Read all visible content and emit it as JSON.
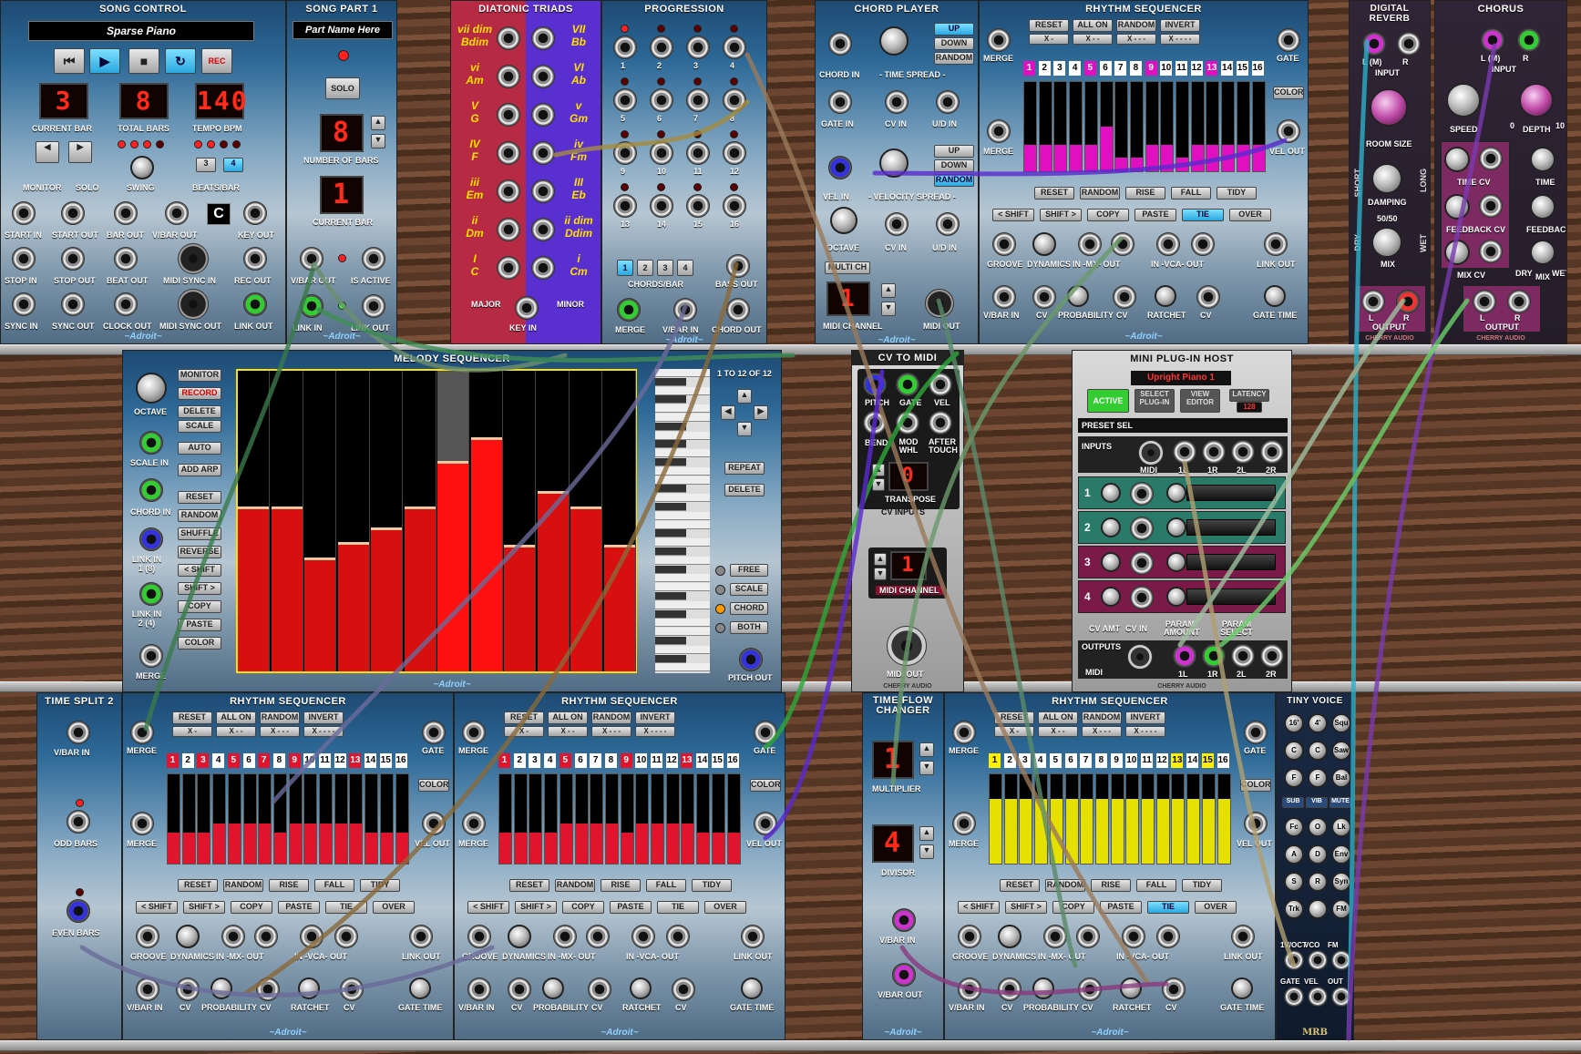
{
  "modules": {
    "song_control": {
      "title": "SONG CONTROL",
      "song_name": "Sparse Piano",
      "rec_label": "REC",
      "displays": {
        "current_bar": "3",
        "total_bars": "8",
        "tempo": "140"
      },
      "labels": [
        "CURRENT BAR",
        "TOTAL BARS",
        "TEMPO BPM",
        "MONITOR",
        "SOLO",
        "SWING",
        "BEATS/BAR",
        "START IN",
        "START OUT",
        "BAR OUT",
        "V/BAR OUT",
        "KEY OUT",
        "STOP IN",
        "STOP OUT",
        "BEAT OUT",
        "MIDI SYNC IN",
        "REC OUT",
        "SYNC IN",
        "SYNC OUT",
        "CLOCK OUT",
        "MIDI SYNC OUT",
        "LINK OUT"
      ],
      "beats": [
        "3",
        "4"
      ],
      "key": "C",
      "brand": "~Adroit~"
    },
    "song_part": {
      "title": "SONG PART 1",
      "part_name": "Part Name Here",
      "solo": "SOLO",
      "number_of_bars": "8",
      "current_bar": "1",
      "labels": [
        "NUMBER OF BARS",
        "CURRENT BAR",
        "V/BAR OUT",
        "IS ACTIVE",
        "LINK IN",
        "LINK OUT"
      ],
      "brand": "~Adroit~"
    },
    "diatonic": {
      "title": "DIATONIC TRIADS",
      "major": [
        {
          "d": "vii dim",
          "c": "Bdim"
        },
        {
          "d": "vi",
          "c": "Am"
        },
        {
          "d": "V",
          "c": "G"
        },
        {
          "d": "IV",
          "c": "F"
        },
        {
          "d": "iii",
          "c": "Em"
        },
        {
          "d": "ii",
          "c": "Dm"
        },
        {
          "d": "I",
          "c": "C"
        }
      ],
      "minor": [
        {
          "d": "VII",
          "c": "Bb"
        },
        {
          "d": "VI",
          "c": "Ab"
        },
        {
          "d": "v",
          "c": "Gm"
        },
        {
          "d": "iv",
          "c": "Fm"
        },
        {
          "d": "III",
          "c": "Eb"
        },
        {
          "d": "ii dim",
          "c": "Ddim"
        },
        {
          "d": "i",
          "c": "Cm"
        }
      ],
      "major_lbl": "MAJOR",
      "minor_lbl": "MINOR",
      "key_in": "KEY IN"
    },
    "progression": {
      "title": "PROGRESSION",
      "steps": [
        "1",
        "2",
        "3",
        "4",
        "5",
        "6",
        "7",
        "8",
        "9",
        "10",
        "11",
        "12",
        "13",
        "14",
        "15",
        "16"
      ],
      "chords_per_bar": [
        "1",
        "2",
        "3",
        "4"
      ],
      "labels": [
        "CHORDS/BAR",
        "BASS OUT",
        "MERGE",
        "V/BAR IN",
        "CHORD OUT"
      ],
      "brand": "~Adroit~"
    },
    "chord_player": {
      "title": "CHORD PLAYER",
      "modes": [
        "UP",
        "DOWN",
        "RANDOM"
      ],
      "modes2": [
        "UP",
        "DOWN",
        "RANDOM"
      ],
      "labels": [
        "CHORD IN",
        "- TIME SPREAD -",
        "GATE IN",
        "CV IN",
        "U/D IN",
        "VEL IN",
        "- VELOCITY SPREAD -",
        "OCTAVE",
        "CV IN",
        "U/D IN",
        "MULTI CH",
        "MIDI CHANNEL",
        "MIDI OUT"
      ],
      "midi_channel": "1",
      "brand": "~Adroit~"
    },
    "rhythm_top": {
      "title": "RHYTHM SEQUENCER",
      "brand": "~Adroit~"
    },
    "reverb": {
      "title": "DIGITAL REVERB",
      "labels": [
        "L (M)",
        "R",
        "INPUT",
        "ROOM SIZE",
        "SHORT",
        "LONG",
        "DAMPING",
        "DRY",
        "WET",
        "50/50",
        "MIX",
        "OUTPUT",
        "L",
        "R"
      ],
      "brand": "CHERRY AUDIO"
    },
    "chorus": {
      "title": "CHORUS",
      "labels": [
        "L (M)",
        "R",
        "INPUT",
        "SPEED",
        "0",
        "DEPTH",
        "10",
        "TIME CV",
        "TIME",
        "FEEDBACK CV",
        "FEEDBACK",
        "MIX CV",
        "DRY",
        "MIX",
        "WET",
        "OUTPUT",
        "L",
        "R"
      ],
      "brand": "CHERRY AUDIO"
    },
    "melody": {
      "title": "MELODY SEQUENCER",
      "range": "1 TO 12 OF 12",
      "buttons": [
        "MONITOR",
        "RECORD",
        "DELETE",
        "SCALE",
        "AUTO",
        "ADD ARP",
        "RESET",
        "RANDOM",
        "SHUFFLE",
        "REVERSE",
        "< SHIFT",
        "SHIFT >",
        "COPY",
        "PASTE",
        "COLOR"
      ],
      "right_buttons": [
        "REPEAT",
        "DELETE"
      ],
      "modes": [
        "FREE",
        "SCALE",
        "CHORD",
        "BOTH"
      ],
      "labels": [
        "OCTAVE",
        "SCALE IN",
        "CHORD IN",
        "LINK IN 1 (8)",
        "LINK IN 2 (4)",
        "MERGE",
        "PITCH OUT"
      ],
      "note_levels": [
        0.55,
        0.55,
        0.38,
        0.43,
        0.48,
        0.55,
        0.7,
        0.78,
        0.42,
        0.6,
        0.55,
        0.42
      ],
      "brand": "~Adroit~"
    },
    "cv_to_midi": {
      "title": "CV TO MIDI",
      "labels": [
        "PITCH",
        "GATE",
        "VEL",
        "BEND",
        "MOD WHL",
        "AFTER TOUCH",
        "TRANSPOSE",
        "CV INPUTS",
        "MIDI CHANNEL",
        "MIDI OUT"
      ],
      "transpose": "0",
      "channel": "1",
      "brand": "CHERRY AUDIO"
    },
    "plugin_host": {
      "title": "MINI PLUG-IN HOST",
      "plugin": "Upright Piano 1",
      "buttons": [
        "ACTIVE",
        "SELECT PLUG-IN",
        "VIEW EDITOR",
        "LATENCY"
      ],
      "latency": "128",
      "preset": "PRESET SEL",
      "inputs": "INPUTS",
      "outputs": "OUTPUTS",
      "io": [
        "MIDI",
        "1L",
        "1R",
        "2L",
        "2R"
      ],
      "rows": [
        "1",
        "2",
        "3",
        "4"
      ],
      "row_labels": [
        "CV AMT",
        "CV IN",
        "PARAM AMOUNT",
        "PARAM SELECT"
      ],
      "brand": "CHERRY AUDIO"
    },
    "time_split": {
      "title": "TIME SPLIT 2",
      "labels": [
        "V/BAR IN",
        "ODD BARS",
        "EVEN BARS"
      ]
    },
    "time_flow": {
      "title": "TIME FLOW CHANGER",
      "multiplier": "1",
      "divisor": "4",
      "labels": [
        "MULTIPLIER",
        "DIVISOR",
        "V/BAR IN",
        "V/BAR OUT"
      ],
      "brand": "~Adroit~"
    },
    "tiny_voice": {
      "title": "TINY VOICE",
      "top": [
        "16'",
        "4'",
        "Squ",
        "C",
        "C",
        "Saw",
        "F",
        "F",
        "Bal"
      ],
      "toggles": [
        "SUB",
        "VIB",
        "MUTE"
      ],
      "mid": [
        "Fc",
        "O",
        "Lk",
        "A",
        "D",
        "Env",
        "S",
        "R",
        "Syn",
        "Trk",
        "",
        "FM"
      ],
      "bottom": [
        "1V/OCT",
        "VCO",
        "FM",
        "GATE",
        "VEL",
        "OUT"
      ],
      "brand": "MRB"
    }
  },
  "rhythm": {
    "top_row": [
      "RESET",
      "ALL ON",
      "RANDOM",
      "INVERT"
    ],
    "top_row2": [
      "X -",
      "X - -",
      "X - - -",
      "X - - - -"
    ],
    "steps": [
      "1",
      "2",
      "3",
      "4",
      "5",
      "6",
      "7",
      "8",
      "9",
      "10",
      "11",
      "12",
      "13",
      "14",
      "15",
      "16"
    ],
    "bottom_row": [
      "RESET",
      "RANDOM",
      "RISE",
      "FALL",
      "TIDY"
    ],
    "edit_row": [
      "< SHIFT",
      "SHIFT >",
      "COPY",
      "PASTE",
      "TIE",
      "OVER"
    ],
    "labels": [
      "MERGE",
      "GATE",
      "COLOR",
      "MERGE",
      "VEL OUT",
      "GROOVE",
      "DYNAMICS",
      "IN -MX- OUT",
      "IN -VCA- OUT",
      "LINK OUT",
      "V/BAR IN",
      "CV",
      "PROBABILITY",
      "CV",
      "RATCHET",
      "CV",
      "GATE TIME"
    ],
    "seq_top": {
      "color": "#e010c0",
      "hl": [
        0,
        4,
        8,
        12
      ],
      "levels": [
        0.3,
        0.3,
        0.3,
        0.3,
        0.3,
        0.5,
        0.15,
        0.15,
        0.3,
        0.3,
        0.15,
        0.3,
        0.3,
        0.3,
        0.3,
        0.3
      ]
    },
    "seq_a": {
      "color": "#e0142d",
      "hl": [
        0,
        2,
        4,
        6,
        8,
        12
      ],
      "levels": [
        0.35,
        0.35,
        0.35,
        0.45,
        0.45,
        0.45,
        0.45,
        0.35,
        0.45,
        0.45,
        0.45,
        0.45,
        0.45,
        0.35,
        0.35,
        0.35
      ]
    },
    "seq_b": {
      "color": "#e0142d",
      "hl": [
        0,
        4,
        8,
        12
      ],
      "levels": [
        0.35,
        0.35,
        0.35,
        0.35,
        0.45,
        0.45,
        0.45,
        0.45,
        0.35,
        0.45,
        0.45,
        0.45,
        0.45,
        0.35,
        0.35,
        0.35
      ]
    },
    "seq_c": {
      "color": "#e5e000",
      "hl": [
        0,
        12,
        14
      ],
      "levels": [
        0.72,
        0.72,
        0.72,
        0.72,
        0.72,
        0.72,
        0.72,
        0.72,
        0.72,
        0.72,
        0.72,
        0.72,
        0.72,
        0.72,
        0.72,
        0.72
      ]
    }
  }
}
